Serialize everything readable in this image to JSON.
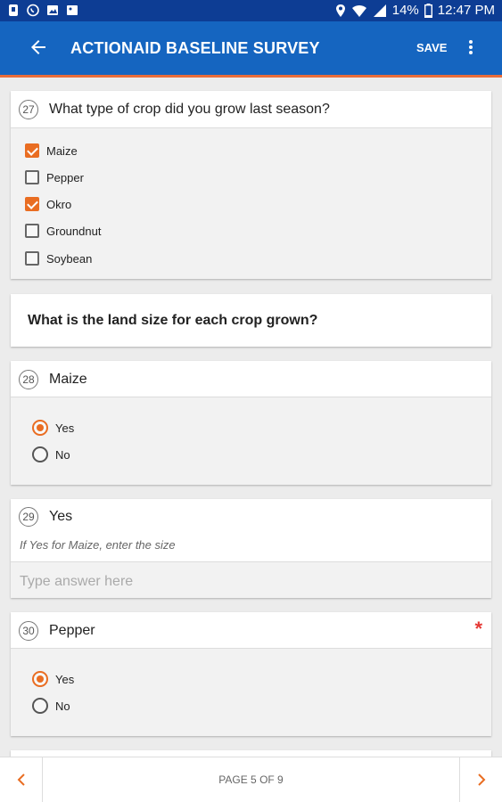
{
  "status_bar": {
    "battery": "14%",
    "time": "12:47 PM"
  },
  "app_bar": {
    "title": "ACTIONAID BASELINE SURVEY",
    "save_label": "SAVE"
  },
  "questions": {
    "q27": {
      "number": "27",
      "text": "What type of crop did you grow last season?",
      "options": [
        {
          "label": "Maize",
          "checked": true
        },
        {
          "label": "Pepper",
          "checked": false
        },
        {
          "label": "Okro",
          "checked": true
        },
        {
          "label": "Groundnut",
          "checked": false
        },
        {
          "label": "Soybean",
          "checked": false
        }
      ]
    },
    "section": {
      "text": "What is the land size for each crop grown?"
    },
    "q28": {
      "number": "28",
      "text": "Maize",
      "options": [
        {
          "label": "Yes",
          "selected": true
        },
        {
          "label": "No",
          "selected": false
        }
      ]
    },
    "q29": {
      "number": "29",
      "text": "Yes",
      "hint": "If  Yes for Maize, enter the size",
      "placeholder": "Type answer here"
    },
    "q30": {
      "number": "30",
      "text": "Pepper",
      "required_mark": "*",
      "options": [
        {
          "label": "Yes",
          "selected": true
        },
        {
          "label": "No",
          "selected": false
        }
      ]
    }
  },
  "pagination": {
    "label": "PAGE 5 OF 9"
  },
  "colors": {
    "status_bar": "#0d3d94",
    "app_bar": "#1565c0",
    "accent": "#e96d22",
    "required": "#e53935"
  },
  "icons": [
    "back-arrow-icon",
    "more-vert-icon",
    "chevron-left-icon",
    "chevron-right-icon",
    "wifi-icon",
    "signal-icon",
    "battery-icon",
    "location-icon"
  ]
}
